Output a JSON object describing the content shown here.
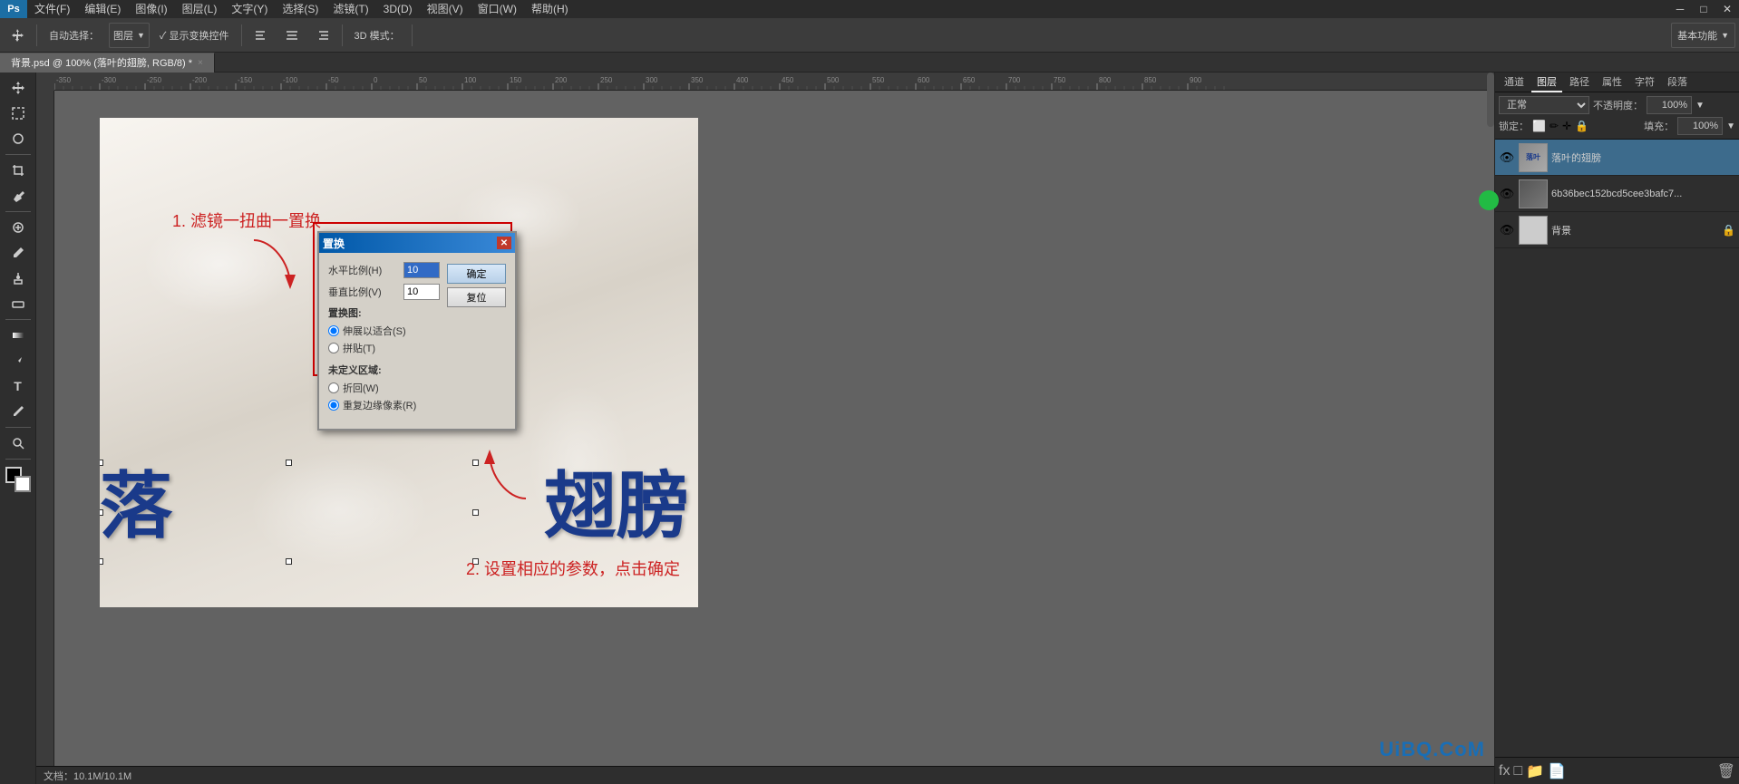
{
  "app": {
    "title": "Photoshop",
    "logo": "Ps"
  },
  "menu": {
    "items": [
      "文件(F)",
      "编辑(E)",
      "图像(I)",
      "图层(L)",
      "文字(Y)",
      "选择(S)",
      "滤镜(T)",
      "3D(D)",
      "视图(V)",
      "窗口(W)",
      "帮助(H)"
    ]
  },
  "window_controls": {
    "minimize": "─",
    "maximize": "□",
    "close": "✕"
  },
  "toolbar": {
    "auto_select_label": "自动选择：",
    "auto_select_value": "图层",
    "show_transform_label": "✓ 显示变换控件",
    "mode_label": "3D 模式：",
    "preset_label": "基本功能"
  },
  "tab": {
    "name": "背景.psd @ 100% (落叶的翅膀, RGB/8) *",
    "close": "×"
  },
  "left_tools": [
    "M",
    "V",
    "⬚",
    "⊙",
    "✏",
    "✒",
    "S",
    "◻",
    "⌫",
    "▲",
    "T",
    "↗",
    "🔍",
    "⬛",
    "⬜"
  ],
  "canvas": {
    "annotation1": "1. 滤镜一扭曲一置换",
    "annotation2": "2. 设置相应的参数，点击确定",
    "big_text_left": "落",
    "big_text_right": "翅膀"
  },
  "dialog": {
    "title": "置换",
    "close_btn": "✕",
    "h_scale_label": "水平比例(H)",
    "h_scale_value": "10",
    "v_scale_label": "垂直比例(V)",
    "v_scale_value": "10",
    "displacement_map_section": "置换图:",
    "radio1_label": "伸展以适合(S)",
    "radio2_label": "拼贴(T)",
    "undefined_area_section": "未定义区域:",
    "radio3_label": "折回(W)",
    "radio4_label": "重复边缘像素(R)",
    "ok_btn": "确定",
    "reset_btn": "复位"
  },
  "right_panel": {
    "tabs": [
      "通道",
      "图层",
      "路径",
      "属性",
      "字符",
      "段落"
    ],
    "blend_mode": "正常",
    "opacity_label": "不透明度：",
    "opacity_value": "100%",
    "fill_label": "填充：",
    "fill_value": "100%",
    "lock_label": "锁定：",
    "layers": [
      {
        "name": "落叶的翅膀",
        "visible": true,
        "active": true,
        "thumb_color": "#888"
      },
      {
        "name": "6b36bec152bcd5cee3bafc7...",
        "visible": true,
        "active": false,
        "thumb_color": "#666"
      },
      {
        "name": "背景",
        "visible": true,
        "active": false,
        "thumb_color": "#ddd",
        "locked": true
      }
    ]
  },
  "status_bar": {
    "info": "文档：10.1M/10.1M"
  },
  "watermark": "UiBQ.CoM"
}
